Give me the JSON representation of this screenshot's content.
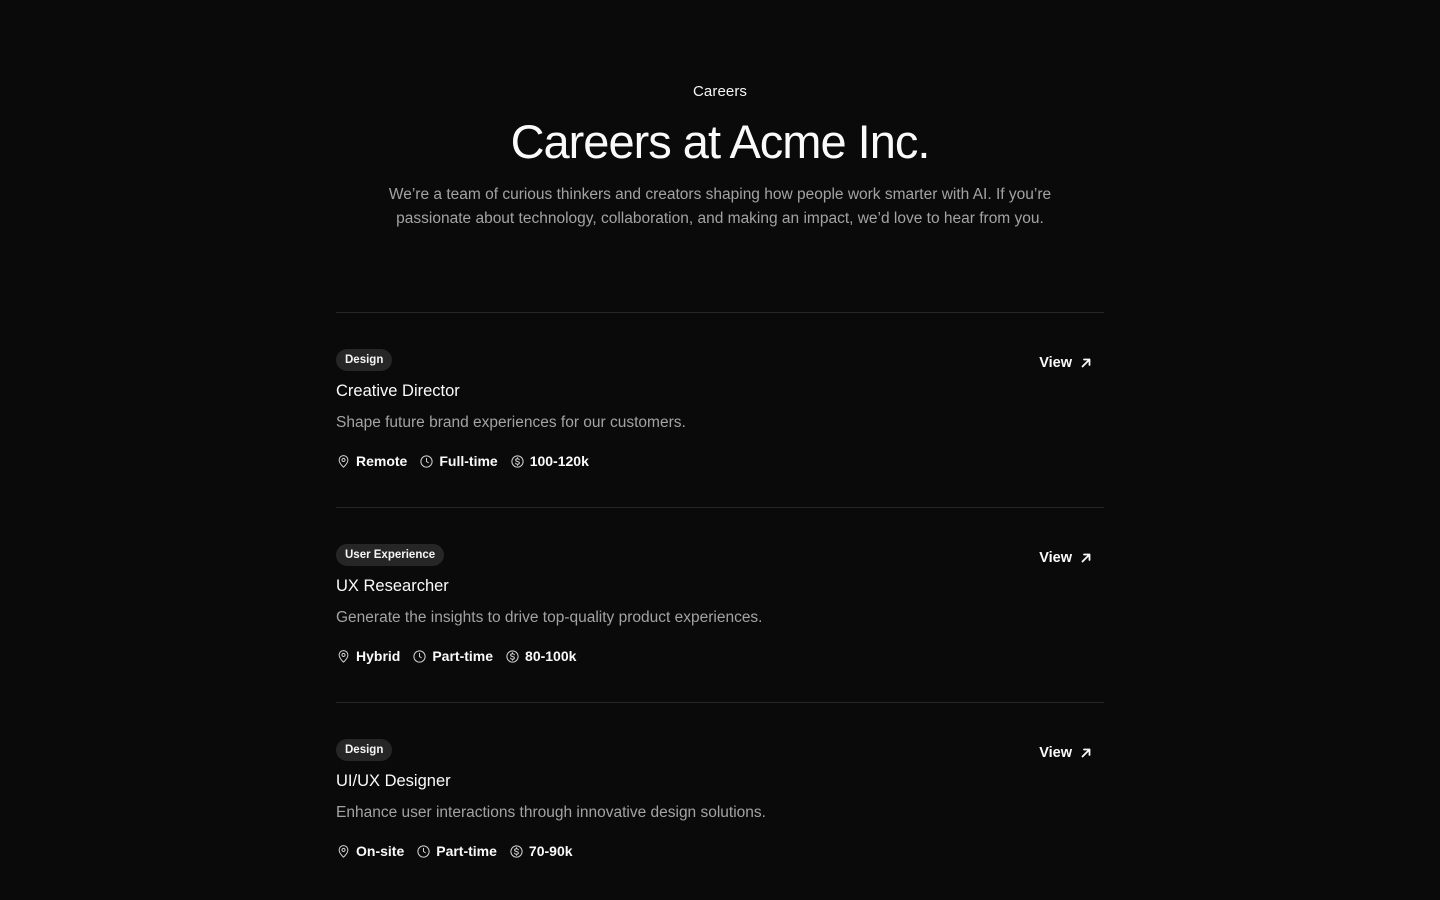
{
  "header": {
    "eyebrow": "Careers",
    "title": "Careers at Acme Inc.",
    "subtitle": "We’re a team of curious thinkers and creators shaping how people work smarter with AI. If you’re passionate about technology, collaboration, and making an impact, we’d love to hear from you."
  },
  "jobs": [
    {
      "tag": "Design",
      "title": "Creative Director",
      "description": "Shape future brand experiences for our customers.",
      "location": "Remote",
      "type": "Full-time",
      "salary": "100-120k",
      "link_label": "View"
    },
    {
      "tag": "User Experience",
      "title": "UX Researcher",
      "description": "Generate the insights to drive top-quality product experiences.",
      "location": "Hybrid",
      "type": "Part-time",
      "salary": "80-100k",
      "link_label": "View"
    },
    {
      "tag": "Design",
      "title": "UI/UX Designer",
      "description": "Enhance user interactions through innovative design solutions.",
      "location": "On-site",
      "type": "Part-time",
      "salary": "70-90k",
      "link_label": "View"
    }
  ],
  "icons": {
    "location": "map-pin-icon",
    "type": "clock-icon",
    "salary": "dollar-circle-icon",
    "link": "arrow-up-right-icon"
  },
  "colors": {
    "background": "#0a0a0a",
    "text": "#fafafa",
    "muted": "#a3a3a3",
    "badge": "#262626",
    "divider": "#262626"
  }
}
